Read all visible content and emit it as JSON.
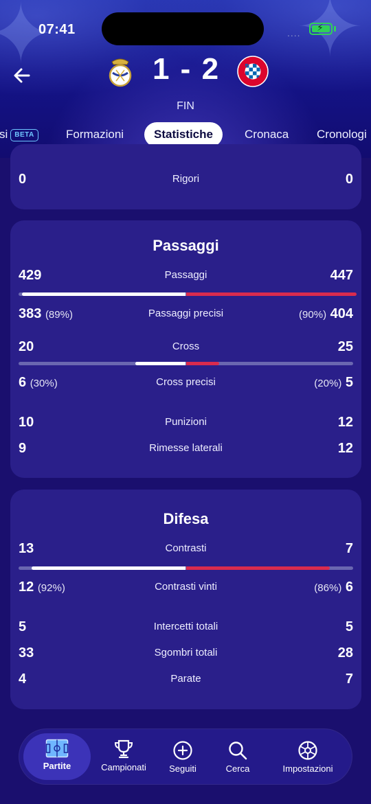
{
  "status_bar": {
    "time": "07:41",
    "signal": "...."
  },
  "match": {
    "home_score": "1",
    "separator": "-",
    "away_score": "2",
    "status": "FIN"
  },
  "tabs": [
    {
      "label": "si",
      "badge": "BETA"
    },
    {
      "label": "Formazioni"
    },
    {
      "label": "Statistiche",
      "active": true
    },
    {
      "label": "Cronaca"
    },
    {
      "label": "Cronologi"
    }
  ],
  "rigori_card": {
    "left": "0",
    "label": "Rigori",
    "right": "0"
  },
  "passaggi_card": {
    "title": "Passaggi",
    "rows": [
      {
        "left": "429",
        "label": "Passaggi",
        "right": "447"
      },
      {
        "left": "383",
        "left_pct": "(89%)",
        "label": "Passaggi precisi",
        "right_pct": "(90%)",
        "right": "404"
      },
      {
        "left": "20",
        "label": "Cross",
        "right": "25"
      },
      {
        "left": "6",
        "left_pct": "(30%)",
        "label": "Cross precisi",
        "right_pct": "(20%)",
        "right": "5"
      },
      {
        "left": "10",
        "label": "Punizioni",
        "right": "12"
      },
      {
        "left": "9",
        "label": "Rimesse laterali",
        "right": "12"
      }
    ],
    "bars": [
      {
        "home_share": 0.49,
        "away_share": 0.51
      },
      {
        "home_share": 0.15,
        "away_share": 0.1
      }
    ]
  },
  "difesa_card": {
    "title": "Difesa",
    "rows": [
      {
        "left": "13",
        "label": "Contrasti",
        "right": "7"
      },
      {
        "left": "12",
        "left_pct": "(92%)",
        "label": "Contrasti vinti",
        "right_pct": "(86%)",
        "right": "6"
      },
      {
        "left": "5",
        "label": "Intercetti totali",
        "right": "5"
      },
      {
        "left": "33",
        "label": "Sgombri totali",
        "right": "28"
      },
      {
        "left": "4",
        "label": "Parate",
        "right": "7"
      }
    ],
    "bars": [
      {
        "home_share": 0.46,
        "away_share": 0.43
      }
    ]
  },
  "bottom_nav": [
    {
      "label": "Partite",
      "icon": "pitch-icon",
      "active": true
    },
    {
      "label": "Campionati",
      "icon": "trophy-icon"
    },
    {
      "label": "Seguiti",
      "icon": "plus-circle-icon"
    },
    {
      "label": "Cerca",
      "icon": "search-icon"
    },
    {
      "label": "Impostazioni",
      "icon": "settings-icon"
    }
  ],
  "colors": {
    "background": "#1a0f6e",
    "card": "#2a1f8a",
    "home_bar": "#ffffff",
    "away_bar": "#d92b4e",
    "beta_badge": "#6fc6ff",
    "battery": "#30d158"
  }
}
